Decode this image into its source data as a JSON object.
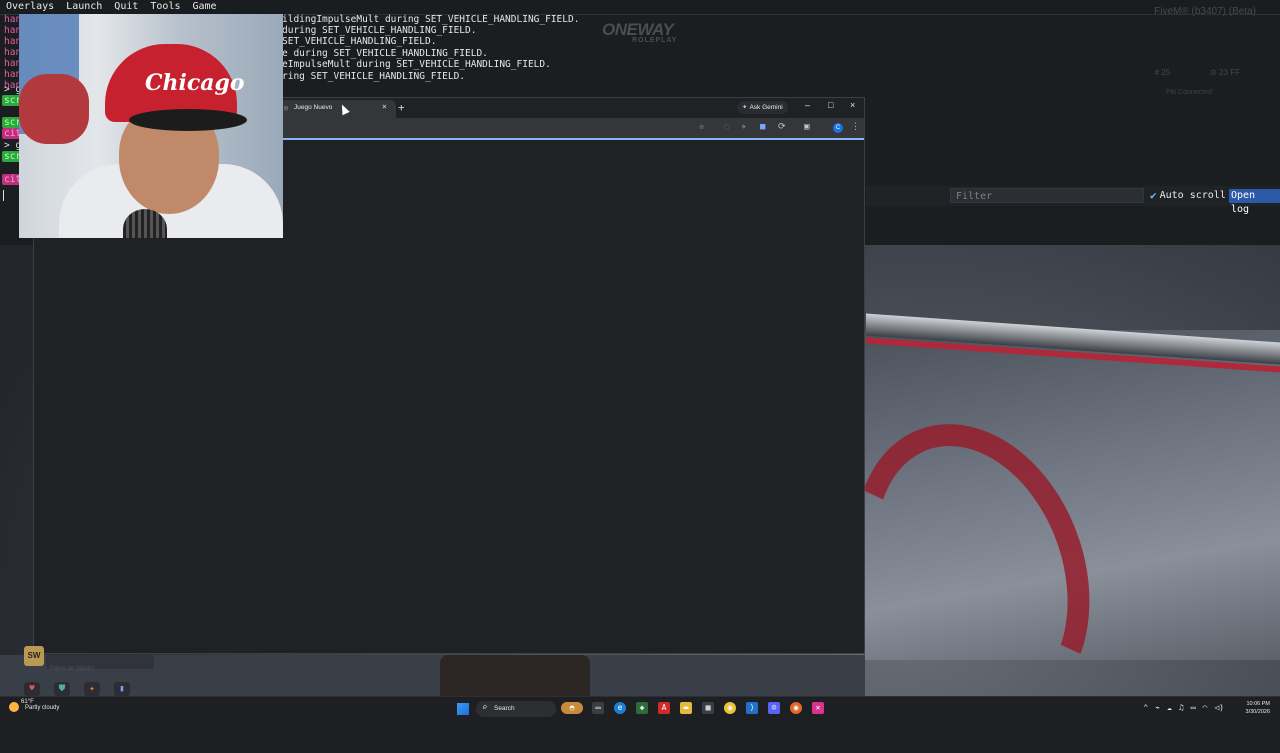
{
  "menubar": {
    "items": [
      "Overlays",
      "Launch",
      "Quit",
      "Tools",
      "Game"
    ],
    "build": "FiveM® (b3407) (Beta)"
  },
  "console": {
    "lines": [
      "ildingImpulseMult during SET_VEHICLE_HANDLING_FIELD.",
      " during SET_VEHICLE_HANDLING_FIELD.",
      " SET_VEHICLE_HANDLING_FIELD.",
      "e during SET_VEHICLE_HANDLING_FIELD.",
      "eImpulseMult during SET_VEHICLE_HANDLING_FIELD.",
      "ring SET_VEHICLE_HANDLING_FIELD."
    ],
    "tags": [
      "han",
      "han",
      "han",
      "han",
      "han",
      "han",
      "han",
      "han",
      "> g",
      "scr",
      "scr",
      "cit",
      "> g",
      "scr",
      "cit"
    ],
    "watermark_top": "ONEWAY",
    "watermark_bottom": "ROLEPLAY",
    "stat_1": "# 25",
    "stat_2": "⊙ 23 FF",
    "stat_sub": "Pkt Connected"
  },
  "filterbar": {
    "filter_placeholder": "Filter",
    "autoscroll_label": "Auto scroll",
    "openlog_label": "Open log"
  },
  "webcam": {
    "cap_text": "Chicago"
  },
  "browser": {
    "tab_title": "Juego Nuevo",
    "tab_close": "×",
    "new_tab": "+",
    "gemini_label": "Ask Gemini",
    "minimize": "–",
    "maximize": "□",
    "close": "×",
    "profile_initial": "C"
  },
  "hud": {
    "sw_label": "SW",
    "sw_text": "Pillow de (Mode)"
  },
  "taskbar": {
    "temperature": "61°F",
    "condition": "Partly cloudy",
    "search_label": "Search",
    "time": "10:06 PM",
    "date": "3/30/2026"
  },
  "colors": {
    "accent_blue": "#2c5aa8",
    "tag_green": "#2ea83b",
    "tag_magenta": "#c02e7e",
    "chrome_bg": "#202124"
  }
}
